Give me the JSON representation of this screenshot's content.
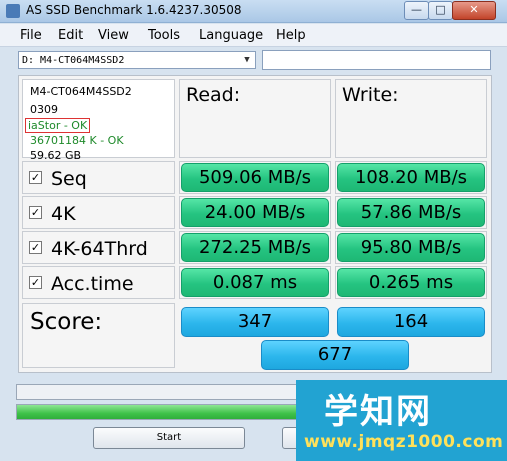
{
  "window": {
    "title": "AS SSD Benchmark 1.6.4237.30508",
    "close_glyph": "✕",
    "max_glyph": "□",
    "min_glyph": "—"
  },
  "menu": [
    "File",
    "Edit",
    "View",
    "Tools",
    "Language",
    "Help"
  ],
  "drive_select": {
    "value": "D: M4-CT064M4SSD2",
    "arrow": "▼"
  },
  "info": {
    "model": "M4-CT064M4SSD2",
    "firmware": "0309",
    "driver": "iaStor - OK",
    "alignment": "36701184 K - OK",
    "size": "59.62 GB"
  },
  "headers": {
    "read": "Read:",
    "write": "Write:"
  },
  "rows": [
    {
      "label": "Seq",
      "read": "509.06 MB/s",
      "write": "108.20 MB/s",
      "check": "✓"
    },
    {
      "label": "4K",
      "read": "24.00 MB/s",
      "write": "57.86 MB/s",
      "check": "✓"
    },
    {
      "label": "4K-64Thrd",
      "read": "272.25 MB/s",
      "write": "95.80 MB/s",
      "check": "✓"
    },
    {
      "label": "Acc.time",
      "read": "0.087 ms",
      "write": "0.265 ms",
      "check": "✓"
    }
  ],
  "score": {
    "label": "Score:",
    "read": "347",
    "write": "164",
    "total": "677"
  },
  "progress": {
    "top_fraction": 0.0,
    "bottom_fraction": 1.0
  },
  "buttons": {
    "start": "Start"
  },
  "watermark": {
    "title": "学知网",
    "url": "www.jmqz1000.com"
  }
}
